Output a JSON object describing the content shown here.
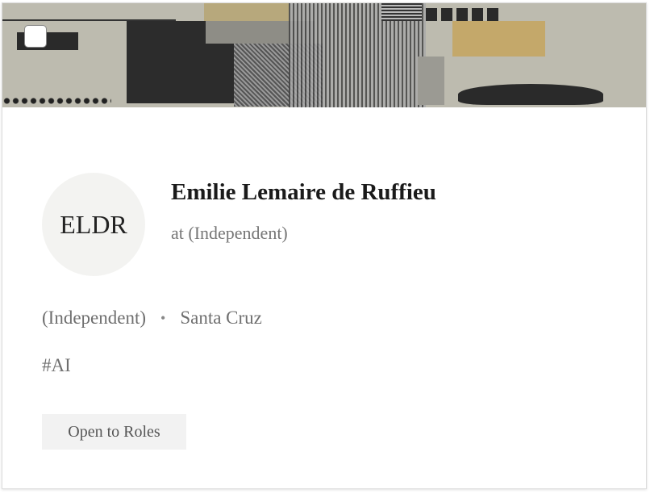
{
  "profile": {
    "initials": "ELDR",
    "name": "Emilie Lemaire de Ruffieu",
    "subtitle": "at (Independent)",
    "company": "(Independent)",
    "separator": "•",
    "location": "Santa Cruz",
    "tag": "#AI",
    "action_label": "Open to Roles"
  }
}
